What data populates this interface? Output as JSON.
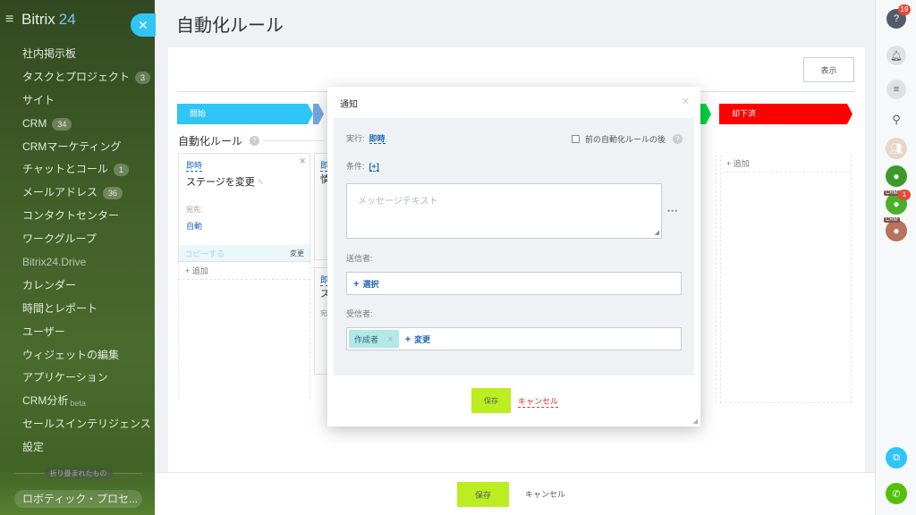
{
  "sidebar": {
    "brand": "Bitrix",
    "brand_num": "24",
    "items": [
      {
        "label": "社内掲示板"
      },
      {
        "label": "タスクとプロジェクト",
        "badge": "3"
      },
      {
        "label": "サイト"
      },
      {
        "label": "CRM",
        "badge": "34"
      },
      {
        "label": "CRMマーケティング"
      },
      {
        "label": "チャットとコール",
        "badge": "1"
      },
      {
        "label": "メールアドレス",
        "badge": "36"
      },
      {
        "label": "コンタクトセンター"
      },
      {
        "label": "ワークグループ"
      },
      {
        "label": "Bitrix24.Drive"
      },
      {
        "label": "カレンダー"
      },
      {
        "label": "時間とレポート"
      },
      {
        "label": "ユーザー"
      },
      {
        "label": "ウィジェットの編集"
      },
      {
        "label": "アプリケーション"
      },
      {
        "label": "CRM分析",
        "sup": "beta"
      },
      {
        "label": "セールスインテリジェンス"
      },
      {
        "label": "設定"
      }
    ],
    "hidden_label": "折り畳まれたもの",
    "bottom_item": "ロボティック・プロセ..."
  },
  "page": {
    "title": "自動化ルール",
    "show_button": "表示",
    "stages": [
      {
        "label": "開始",
        "color": "#2fc6f6"
      },
      {
        "label": "却下済",
        "color": "#ff0000"
      }
    ],
    "rules_title": "自動化ルール",
    "card": {
      "when": "即時",
      "name": "ステージを変更",
      "to_label": "宛先:",
      "to": "自動",
      "copy": "コピーする",
      "change": "変更"
    },
    "card2": {
      "when": "即時",
      "name": "慎"
    },
    "card3": {
      "when": "即",
      "name": "ス",
      "to_label": "宛"
    },
    "add_label": "追加",
    "save": "保存",
    "cancel": "キャンセル"
  },
  "dialog": {
    "title": "通知",
    "run_label": "実行:",
    "run_value": "即時",
    "after_prev": "前の自動化ルールの後",
    "cond_label": "条件:",
    "cond_value": "[+]",
    "message_placeholder": "メッセージテキスト",
    "sender_label": "送信者:",
    "sender_select": "選択",
    "recipient_label": "受信者:",
    "recipient_tag": "作成者",
    "recipient_change": "変更",
    "save": "保存",
    "cancel": "キャンセル"
  },
  "rightbar": {
    "help_count": "19",
    "crm_tag": "CRM",
    "crm_count": "1"
  },
  "colors": {
    "accent_blue": "#2fc6f6",
    "save_green": "#bbed21",
    "link_blue": "#2067b0"
  }
}
